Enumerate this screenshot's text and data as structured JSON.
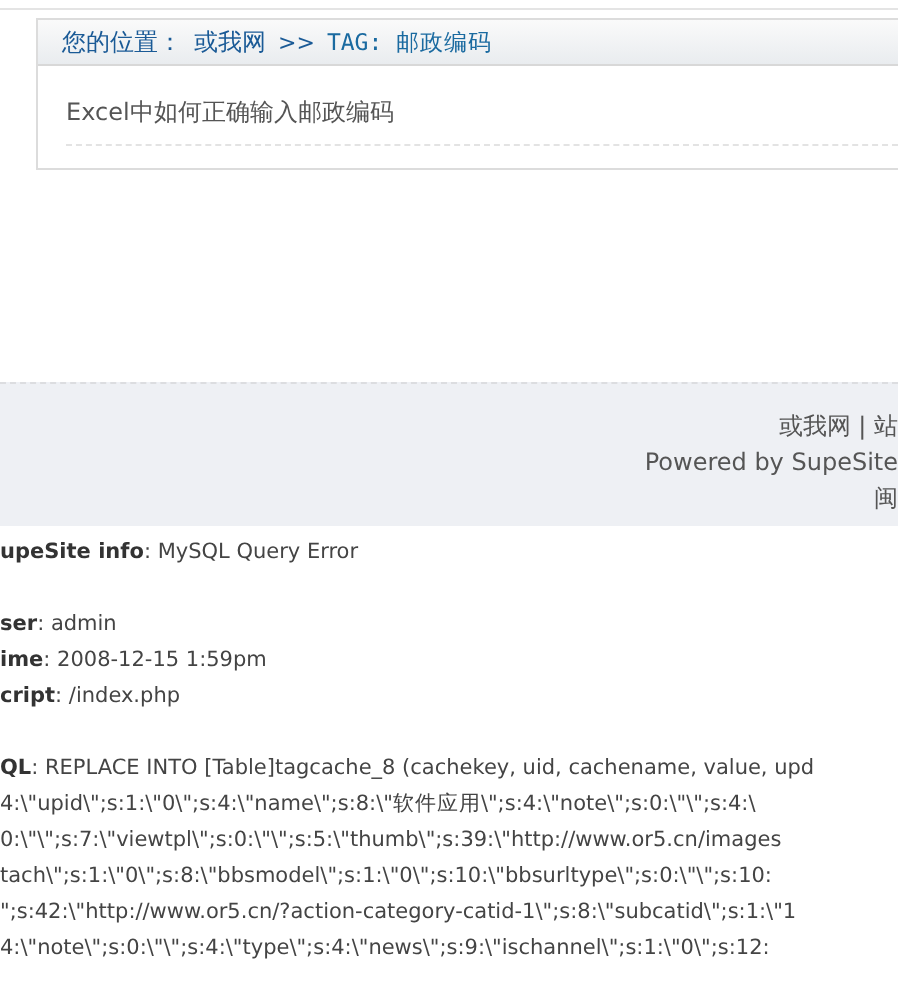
{
  "breadcrumb": {
    "label": "您的位置：",
    "separator": ">>",
    "items": [
      {
        "text": "或我网",
        "kind": "link"
      },
      {
        "text": "TAG: 邮政编码",
        "kind": "current"
      }
    ]
  },
  "articles": [
    {
      "title": "Excel中如何正确输入邮政编码"
    }
  ],
  "footer": {
    "lines": [
      "或我网 | 站",
      "Powered by SupeSite",
      "闽"
    ]
  },
  "error": {
    "groups": [
      [
        "**upeSite info**: MySQL Query Error"
      ],
      [
        "**ser**: admin",
        "**ime**: 2008-12-15 1:59pm",
        "**cript**: /index.php"
      ],
      [
        "**QL**: REPLACE INTO [Table]tagcache_8 (cachekey, uid, cachename, value, upd"
      ]
    ],
    "sql_lines": [
      "4:\\\"upid\\\";s:1:\\\"0\\\";s:4:\\\"name\\\";s:8:\\\"软件应用\\\";s:4:\\\"note\\\";s:0:\\\"\\\";s:4:\\",
      "0:\\\"\\\";s:7:\\\"viewtpl\\\";s:0:\\\"\\\";s:5:\\\"thumb\\\";s:39:\\\"http://www.or5.cn/images",
      "tach\\\";s:1:\\\"0\\\";s:8:\\\"bbsmodel\\\";s:1:\\\"0\\\";s:10:\\\"bbsurltype\\\";s:0:\\\"\\\";s:10:",
      "\";s:42:\\\"http://www.or5.cn/?action-category-catid-1\\\";s:8:\\\"subcatid\\\";s:1:\\\"1",
      "4:\\\"note\\\";s:0:\\\"\\\";s:4:\\\"type\\\";s:4:\\\"news\\\";s:9:\\\"ischannel\\\";s:1:\\\"0\\\";s:12:"
    ]
  }
}
